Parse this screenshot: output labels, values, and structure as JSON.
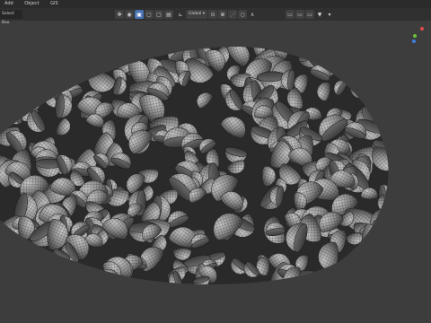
{
  "menu": [
    "Add",
    "Object",
    "GIS"
  ],
  "toolbar": {
    "select_mode": "Select Box",
    "orientation": "Global",
    "snap_icon": "magnet-icon",
    "proportional_icon": "proportional-edit-icon"
  },
  "colors": {
    "background": "#3d3d3d",
    "accent": "#4772b3",
    "gizmo_x": "#e04a4a",
    "gizmo_y": "#6cbf3a",
    "gizmo_z": "#3f7fe0"
  }
}
